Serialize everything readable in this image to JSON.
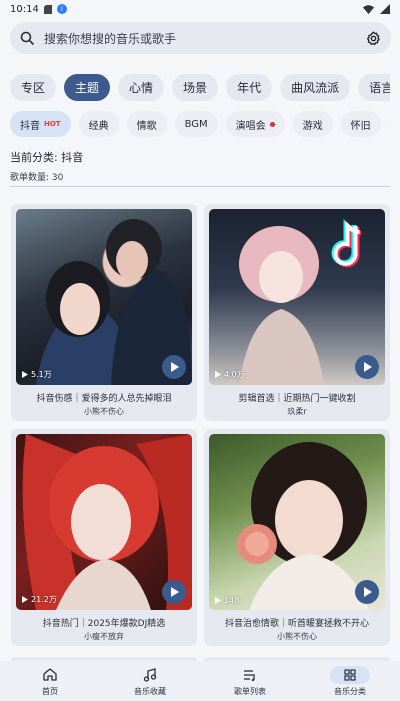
{
  "status": {
    "time": "10:14"
  },
  "search": {
    "placeholder": "搜索你想搜的音乐或歌手"
  },
  "main_tabs": [
    "专区",
    "主题",
    "心情",
    "场景",
    "年代",
    "曲风流派",
    "语言"
  ],
  "sub_tabs": [
    "抖音",
    "经典",
    "情歌",
    "BGM",
    "演唱会",
    "游戏",
    "怀旧",
    "古"
  ],
  "sub_tab_hot": "HOT",
  "info": {
    "category": "当前分类: 抖音",
    "count": "歌单数量: 30"
  },
  "cards": [
    {
      "plays": "5.1万",
      "title": "抖音伤感｜爱得多的人总先掉眼泪",
      "author": "小熊不伤心"
    },
    {
      "plays": "4.0万",
      "title": "剪辑首选｜近期热门一键收割",
      "author": "玖柔r"
    },
    {
      "plays": "21.2万",
      "title": "抖音热门｜2025年爆款DJ精选",
      "author": "小瘦不放弃"
    },
    {
      "plays": "148",
      "title": "抖音治愈情歌｜听首暖宴拯救不开心",
      "author": "小熊不伤心"
    }
  ],
  "nav": [
    "首页",
    "音乐收藏",
    "歌单列表",
    "音乐分类"
  ],
  "colors": {
    "accent": "#3b5b8e",
    "active_chip": "#d6e2f6"
  }
}
